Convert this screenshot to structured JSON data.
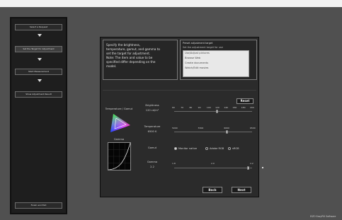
{
  "steps_panel": {
    "buttons": [
      "Select a Request",
      "Set the Target for Adjustment",
      "Start Measurement",
      "Show Adjustment Result",
      "Finish and Exit"
    ]
  },
  "instructions": "Specify the brightness,\ntemperature, gamut, and gamma to\nset the target for adjustment.\nNote: The item and value to be\nspecified differ depending on the\nmodel.",
  "preset": {
    "title": "Preset adjustment target",
    "subtitle": "Set the adjustment target for use",
    "items": [
      "Use/Adjust pictures",
      "Browse Web",
      "Create documents",
      "Watch/Edit movies"
    ]
  },
  "reset_label": "Reset",
  "gamut_label": "Temperature / Gamut",
  "gamma_graph_label": "Gamma",
  "brightness": {
    "label": "Brightness",
    "value": "120 cd/m²",
    "scale": [
      "60",
      "70",
      "80",
      "90",
      "100",
      "120",
      "140",
      "160",
      "180",
      "200"
    ],
    "level": 0.55
  },
  "temperature": {
    "label": "Temperature",
    "value": "6500 K",
    "scale": [
      "5000",
      "5500",
      "6000",
      "6500"
    ],
    "level": 0.68
  },
  "gamut": {
    "label": "Gamut",
    "options": [
      "Monitor native",
      "Adobe RGB",
      "sRGB"
    ],
    "selected": 0
  },
  "gamma": {
    "label": "Gamma",
    "value": "2.2",
    "scale": [
      "1.8",
      "2.0",
      "2.2"
    ],
    "level": 0.95
  },
  "nav": {
    "back": "Back",
    "next": "Next"
  },
  "brand": "EIZO EasyPIX Software",
  "colors": {
    "background": "#505050",
    "panel": "#2b2b2b",
    "steps": "#1e1e1e"
  }
}
